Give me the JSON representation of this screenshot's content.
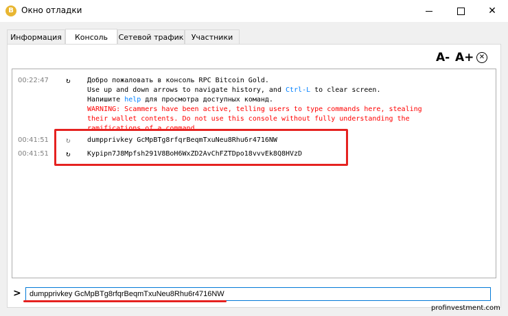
{
  "window": {
    "title": "Окно отладки",
    "app_icon": "bitcoin-gold-icon"
  },
  "tabs": [
    {
      "label": "Информация"
    },
    {
      "label": "Консоль"
    },
    {
      "label": "Сетевой трафик"
    },
    {
      "label": "Участники"
    }
  ],
  "font_controls": {
    "decrease": "A-",
    "increase": "A+",
    "clear": "✕"
  },
  "console": {
    "welcome": {
      "time": "00:22:47",
      "line1": "Добро пожаловать в консоль RPC Bitcoin Gold.",
      "line2_pre": "Use up and down arrows to navigate history, and ",
      "line2_key": "Ctrl-L",
      "line2_post": " to clear screen.",
      "line3_pre": "Напишите ",
      "line3_link": "help",
      "line3_post": " для просмотра доступных команд.",
      "warn1": "WARNING: Scammers have been active, telling users to type commands here, stealing",
      "warn2": "their wallet contents. Do not use this console without fully understanding the",
      "warn3": "ramifications of a command."
    },
    "request": {
      "time": "00:41:51",
      "text": "dumpprivkey GcMpBTg8rfqrBeqmTxuNeu8Rhu6r4716NW"
    },
    "reply": {
      "time": "00:41:51",
      "text": "Kypipn7J8Mpfsh291V8BoH6WxZD2AvChFZTDpo18vvvEk8Q8HVzD"
    }
  },
  "input": {
    "prompt": ">",
    "value": "dumpprivkey GcMpBTg8rfqrBeqmTxuNeu8Rhu6r4716NW"
  },
  "watermark": "profinvestment.com",
  "colors": {
    "highlight": "#e52220",
    "warning": "#ff0000",
    "link": "#0080ff"
  }
}
